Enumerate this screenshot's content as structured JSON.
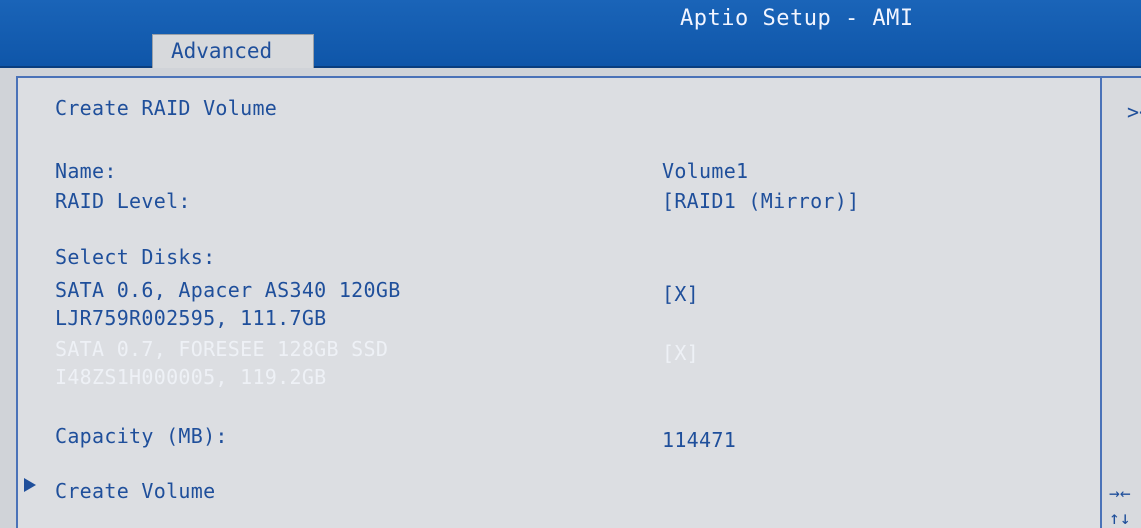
{
  "header": {
    "app_title": "Aptio Setup - AMI",
    "active_tab": "Advanced"
  },
  "main": {
    "section_title": "Create RAID Volume",
    "name_label": "Name:",
    "name_value": "Volume1",
    "raid_level_label": "RAID Level:",
    "raid_level_value": "[RAID1 (Mirror)]",
    "select_disks_label": "Select Disks:",
    "disks": [
      {
        "line1": "SATA 0.6, Apacer AS340 120GB",
        "line2": "LJR759R002595, 111.7GB",
        "checkbox": "[X]"
      },
      {
        "line1": "SATA 0.7, FORESEE 128GB SSD",
        "line2": "I48ZS1H000005, 119.2GB",
        "checkbox": "[X]"
      }
    ],
    "capacity_label": "Capacity (MB):",
    "capacity_value": "114471",
    "create_volume_label": "Create Volume"
  },
  "help_pane": {
    "top_glyph": "><",
    "nav_hint_1": "→←",
    "nav_hint_2": "↑↓"
  },
  "colors": {
    "header_blue": "#1259ac",
    "text_blue": "#1f4f9b",
    "highlight_text": "#eef1f6",
    "panel_bg": "#dcdee2"
  }
}
